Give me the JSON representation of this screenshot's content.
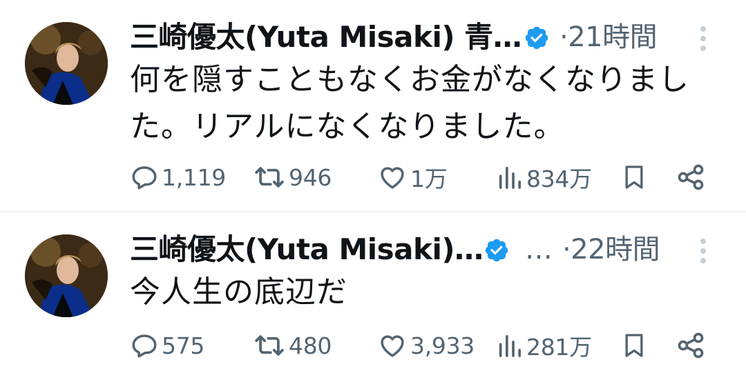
{
  "tweets": [
    {
      "author": "三崎優太(Yuta Misaki) 青…",
      "extra_ellipsis": "",
      "time": "·21時間",
      "text_lines": [
        "何を隠すこともなくお金がなくなりまし",
        "た。リアルになくなりました。"
      ],
      "replies": "1,119",
      "retweets": "946",
      "likes": "1万",
      "views": "834万"
    },
    {
      "author": "三崎優太(Yuta Misaki)…",
      "extra_ellipsis": "…",
      "time": "·22時間",
      "text_lines": [
        "今人生の底辺だ"
      ],
      "replies": "575",
      "retweets": "480",
      "likes": "3,933",
      "views": "281万"
    }
  ],
  "colors": {
    "verified": "#1d9bf0",
    "muted": "#536471",
    "text": "#0f1419",
    "divider": "#eff3f4"
  },
  "icons": [
    "reply-icon",
    "retweet-icon",
    "like-icon",
    "views-icon",
    "bookmark-icon",
    "share-icon",
    "more-icon",
    "verified-badge-icon"
  ]
}
